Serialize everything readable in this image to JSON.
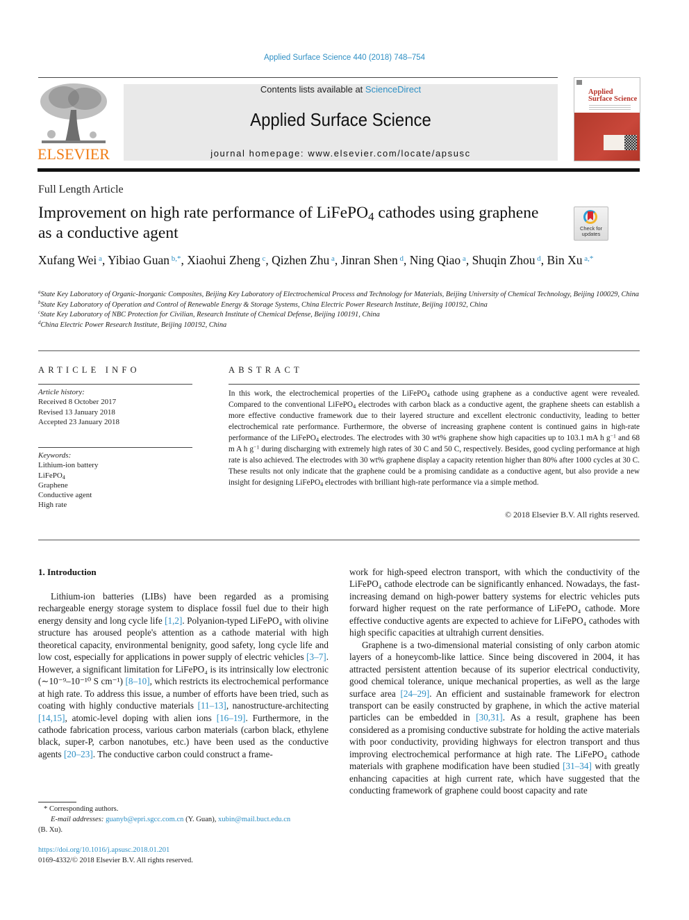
{
  "header": {
    "journal_ref": "Applied Surface Science 440 (2018) 748–754",
    "contents_prefix": "Contents lists available at ",
    "contents_link": "ScienceDirect",
    "journal_title": "Applied Surface Science",
    "homepage_line": "journal homepage: www.elsevier.com/locate/apsusc",
    "publisher_logo_text": "ELSEVIER",
    "cover_title_line1": "Applied",
    "cover_title_line2": "Surface Science",
    "colors": {
      "link": "#2e8fc4",
      "elsevier_orange": "#f07c14",
      "cover_red": "#b8342a"
    }
  },
  "article": {
    "type": "Full Length Article",
    "title_part1": "Improvement on high rate performance of LiFePO",
    "title_sub": "4",
    "title_part2": " cathodes using graphene as a conductive agent",
    "crossmark_line1": "Check for",
    "crossmark_line2": "updates",
    "authors": [
      {
        "name": "Xufang Wei",
        "aff": "a"
      },
      {
        "name": "Yibiao Guan",
        "aff": "b,*"
      },
      {
        "name": "Xiaohui Zheng",
        "aff": "c"
      },
      {
        "name": "Qizhen Zhu",
        "aff": "a"
      },
      {
        "name": "Jinran Shen",
        "aff": "d"
      },
      {
        "name": "Ning Qiao",
        "aff": "a"
      },
      {
        "name": "Shuqin Zhou",
        "aff": "d"
      },
      {
        "name": "Bin Xu",
        "aff": "a,*"
      }
    ],
    "affiliations": [
      {
        "key": "a",
        "text": "State Key Laboratory of Organic-Inorganic Composites, Beijing Key Laboratory of Electrochemical Process and Technology for Materials, Beijing University of Chemical Technology, Beijing 100029, China"
      },
      {
        "key": "b",
        "text": "State Key Laboratory of Operation and Control of Renewable Energy & Storage Systems, China Electric Power Research Institute, Beijing 100192, China"
      },
      {
        "key": "c",
        "text": "State Key Laboratory of NBC Protection for Civilian, Research Institute of Chemical Defense, Beijing 100191, China"
      },
      {
        "key": "d",
        "text": "China Electric Power Research Institute, Beijing 100192, China"
      }
    ]
  },
  "article_info": {
    "heading": "ARTICLE INFO",
    "history_label": "Article history:",
    "received": "Received 8 October 2017",
    "revised": "Revised 13 January 2018",
    "accepted": "Accepted 23 January 2018",
    "keywords_label": "Keywords:",
    "keywords": [
      "Lithium-ion battery",
      "LiFePO4",
      "Graphene",
      "Conductive agent",
      "High rate"
    ]
  },
  "abstract": {
    "heading": "ABSTRACT",
    "segments": [
      "In this work, the electrochemical properties of the LiFePO",
      "4",
      " cathode using graphene as a conductive agent were revealed. Compared to the conventional LiFePO",
      "4",
      " electrodes with carbon black as a conductive agent, the graphene sheets can establish a more effective conductive framework due to their layered structure and excellent electronic conductivity, leading to better electrochemical rate performance. Furthermore, the obverse of increasing graphene content is continued gains in high-rate performance of the LiFePO",
      "4",
      " electrodes. The electrodes with 30 wt% graphene show high capacities up to 103.1 mA h g",
      "−1",
      " and 68 m A h g",
      "−1",
      " during discharging with extremely high rates of 30 C and 50 C, respectively. Besides, good cycling performance at high rate is also achieved. The electrodes with 30 wt% graphene display a capacity retention higher than 80% after 1000 cycles at 30 C. These results not only indicate that the graphene could be a promising candidate as a conductive agent, but also provide a new insight for designing LiFePO",
      "4",
      " electrodes with brilliant high-rate performance via a simple method."
    ],
    "copyright": "© 2018 Elsevier B.V. All rights reserved."
  },
  "introduction": {
    "heading": "1. Introduction",
    "left_p1": [
      "Lithium-ion batteries (LIBs) have been regarded as a promising rechargeable energy storage system to displace fossil fuel due to their high energy density and long cycle life ",
      "[1,2]",
      ". Polyanion-typed LiFePO₄ with olivine structure has aroused people's attention as a cathode material with high theoretical capacity, environmental benignity, good safety, long cycle life and low cost, especially for applications in power supply of electric vehicles ",
      "[3–7]",
      ". However, a significant limitation for LiFePO₄ is its intrinsically low electronic (∼10⁻⁹–10⁻¹⁰ S cm⁻¹) ",
      "[8–10]",
      ", which restricts its electrochemical performance at high rate. To address this issue, a number of efforts have been tried, such as coating with highly conductive materials ",
      "[11–13]",
      ", nanostructure-architecting ",
      "[14,15]",
      ", atomic-level doping with alien ions ",
      "[16–19]",
      ". Furthermore, in the cathode fabrication process, various carbon materials (carbon black, ethylene black, super-P, carbon nanotubes, etc.) have been used as the conductive agents ",
      "[20–23]",
      ". The conductive carbon could construct a frame-"
    ],
    "right_p1": "work for high-speed electron transport, with which the conductivity of the LiFePO₄ cathode electrode can be significantly enhanced. Nowadays, the fast-increasing demand on high-power battery systems for electric vehicles puts forward higher request on the rate performance of LiFePO₄ cathode. More effective conductive agents are expected to achieve for LiFePO₄ cathodes with high specific capacities at ultrahigh current densities.",
    "right_p2": [
      "Graphene is a two-dimensional material consisting of only carbon atomic layers of a honeycomb-like lattice. Since being discovered in 2004, it has attracted persistent attention because of its superior electrical conductivity, good chemical tolerance, unique mechanical properties, as well as the large surface area ",
      "[24–29]",
      ". An efficient and sustainable framework for electron transport can be easily constructed by graphene, in which the active material particles can be embedded in ",
      "[30,31]",
      ". As a result, graphene has been considered as a promising conductive substrate for holding the active materials with poor conductivity, providing highways for electron transport and thus improving electrochemical performance at high rate. The LiFePO₄ cathode materials with graphene modification have been studied ",
      "[31–34]",
      " with greatly enhancing capacities at high current rate, which have suggested that the conducting framework of graphene could boost capacity and rate"
    ]
  },
  "footnotes": {
    "corresponding": "* Corresponding authors.",
    "email_label": "E-mail addresses:",
    "email1": "guanyb@epri.sgcc.com.cn",
    "email1_owner": " (Y. Guan), ",
    "email2": "xubin@mail.buct.edu.cn",
    "email2_owner": "(B. Xu).",
    "doi": "https://doi.org/10.1016/j.apsusc.2018.01.201",
    "issn_line": "0169-4332/© 2018 Elsevier B.V. All rights reserved."
  }
}
